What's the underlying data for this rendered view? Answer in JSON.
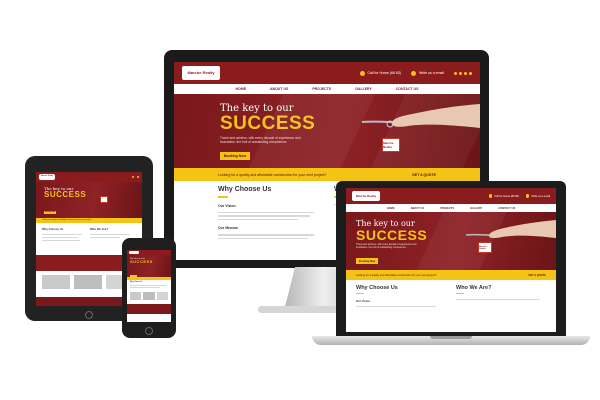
{
  "site": {
    "logo_text": "Marche Realty",
    "call_label": "Call for Home (66 83)",
    "write_label": "Write us a email",
    "nav": [
      "HOME",
      "ABOUT US",
      "PROJECTS",
      "GALLERY",
      "CONTACT US"
    ],
    "hero_small": "The key to our",
    "hero_big": "SUCCESS",
    "hero_desc": "Travel and achieve, with every decade of experience and foundation, the fruit of outstanding competence.",
    "hero_button": "Booking Now",
    "band_text": "Looking for a quality and affordable construction for your next project?",
    "band_link": "GET A QUOTE",
    "why_title": "Why Choose Us",
    "vision_title": "Our Vision",
    "mission_title": "Our Mission",
    "who_title": "Who We Are?"
  },
  "colors": {
    "brand": "#8a1c1e",
    "accent": "#f3c316"
  }
}
